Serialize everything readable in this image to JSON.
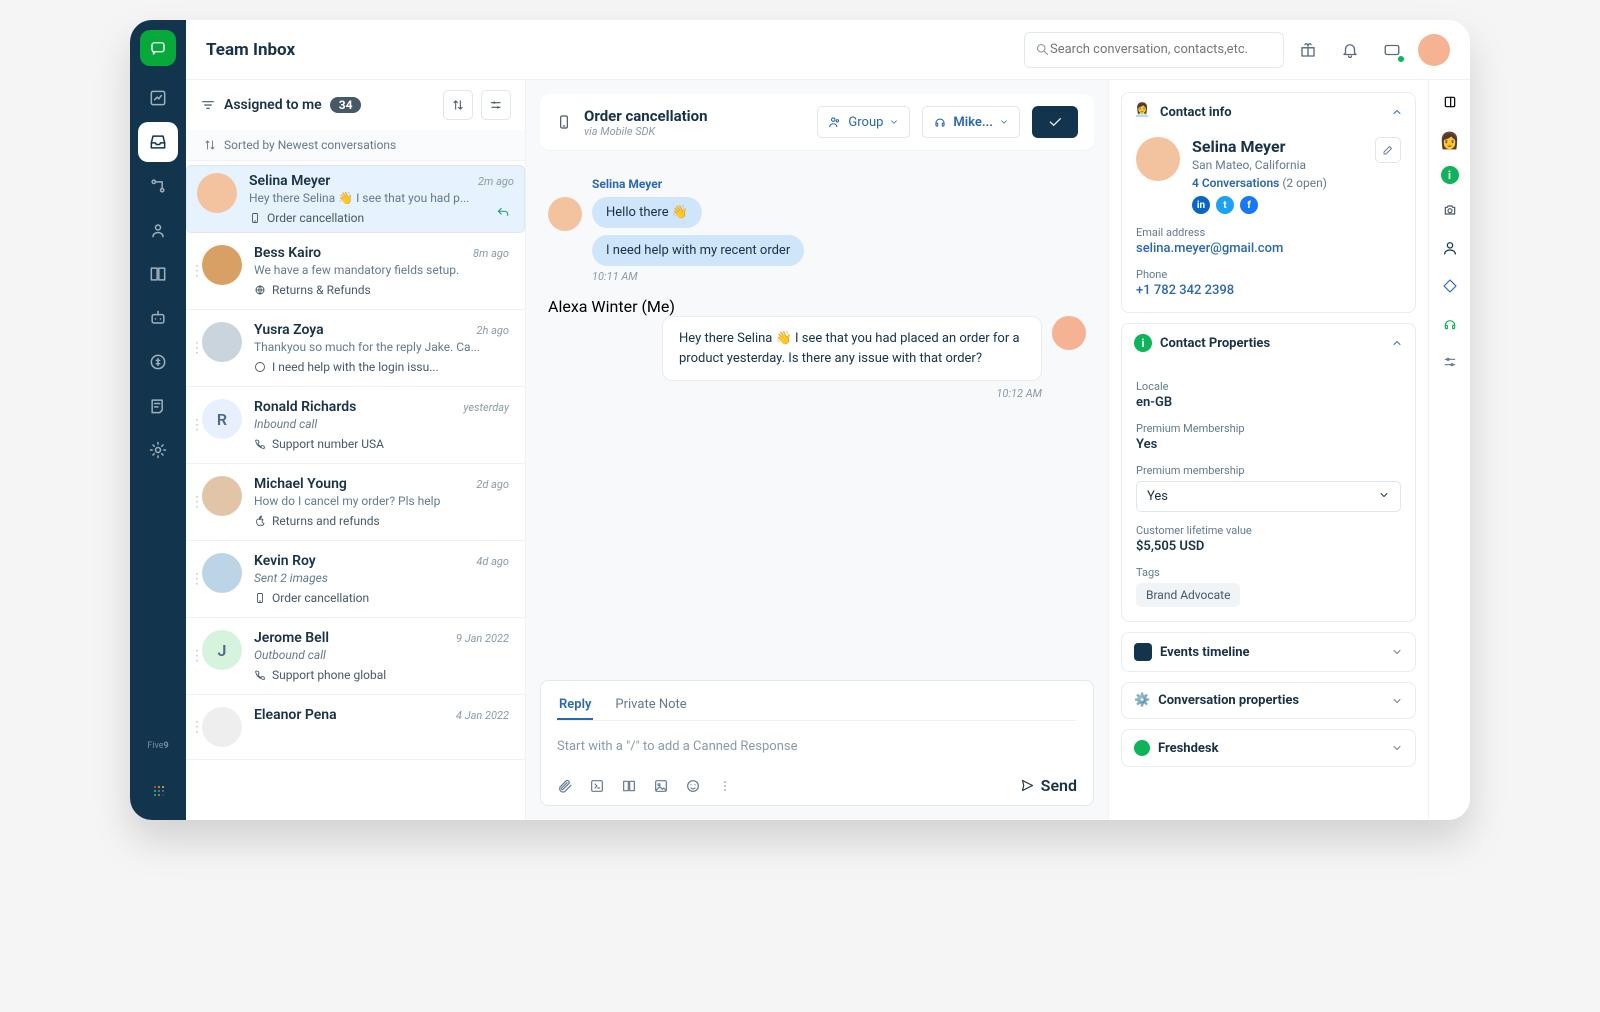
{
  "header": {
    "title": "Team Inbox",
    "search_placeholder": "Search conversation, contacts,etc."
  },
  "filter": {
    "label": "Assigned to me",
    "count": "34",
    "sort": "Sorted by Newest conversations"
  },
  "conversations": [
    {
      "name": "Selina Meyer",
      "time": "2m ago",
      "preview": "Hey there Selina 👋 I see that you had p...",
      "tag": "Order cancellation",
      "channel": "mobile",
      "selected": true,
      "reply": true,
      "avatar": "#f3c3a0"
    },
    {
      "name": "Bess Kairo",
      "time": "8m ago",
      "preview": "We have a few mandatory fields setup.",
      "tag": "Returns & Refunds",
      "channel": "web",
      "avatar": "#d9a066"
    },
    {
      "name": "Yusra Zoya",
      "time": "2h ago",
      "preview": "Thankyou so much for the reply Jake. Ca...",
      "tag": "I need help with the login issu...",
      "channel": "whatsapp",
      "avatar": "#c9d4dc"
    },
    {
      "name": "Ronald Richards",
      "time": "yesterday",
      "preview": "Inbound call",
      "previewItalic": true,
      "tag": "Support number USA",
      "channel": "phone",
      "avatar": "#e8f0ff",
      "initial": "R"
    },
    {
      "name": "Michael Young",
      "time": "2d ago",
      "preview": "How do I cancel my order? Pls help",
      "tag": "Returns and refunds",
      "channel": "apple",
      "avatar": "#e2c5a8"
    },
    {
      "name": "Kevin Roy",
      "time": "4d ago",
      "preview": "Sent 2 images",
      "previewItalic": true,
      "tag": "Order cancellation",
      "channel": "mobile",
      "avatar": "#bcd5e6"
    },
    {
      "name": "Jerome Bell",
      "time": "9 Jan 2022",
      "preview": "Outbound call",
      "previewItalic": true,
      "tag": "Support phone global",
      "channel": "phone",
      "avatar": "#d6f3dd",
      "initial": "J"
    },
    {
      "name": "Eleanor Pena",
      "time": "4 Jan 2022",
      "preview": "",
      "tag": "",
      "avatar": "#eee"
    }
  ],
  "thread": {
    "subject": "Order cancellation",
    "via": "via Mobile SDK",
    "group": "Group",
    "assignee": "Mike...",
    "sender": "Selina Meyer",
    "msgs1": [
      "Hello there 👋",
      "I need help with my recent order"
    ],
    "ts1": "10:11 AM",
    "me": "Alexa Winter (Me)",
    "reply_msg": "Hey there Selina 👋 I see that you had placed an order for a product yesterday. Is there any issue with that order?",
    "ts2": "10:12 AM"
  },
  "compose": {
    "tabs": [
      "Reply",
      "Private Note"
    ],
    "placeholder": "Start with a \"/\" to add a Canned Response",
    "send": "Send"
  },
  "contact": {
    "title": "Contact info",
    "name": "Selina Meyer",
    "location": "San Mateo, California",
    "convs": "4 Conversations",
    "open": "(2 open)",
    "email_label": "Email address",
    "email": "selina.meyer@gmail.com",
    "phone_label": "Phone",
    "phone": "+1 782 342 2398"
  },
  "props": {
    "title": "Contact Properties",
    "locale_l": "Locale",
    "locale_v": "en-GB",
    "pm_l": "Premium Membership",
    "pm_v": "Yes",
    "pm2_l": "Premium membership",
    "pm2_v": "Yes",
    "clv_l": "Customer lifetime value",
    "clv_v": "$5,505 USD",
    "tags_l": "Tags",
    "tag": "Brand Advocate"
  },
  "panels": {
    "timeline": "Events timeline",
    "convprops": "Conversation properties",
    "freshdesk": "Freshdesk"
  }
}
